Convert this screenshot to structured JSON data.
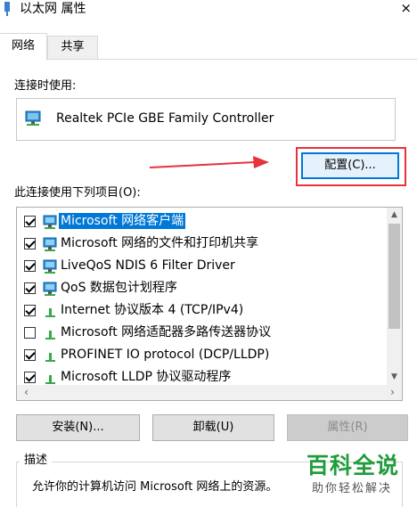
{
  "window": {
    "title": "以太网 属性",
    "close_glyph": "×"
  },
  "tabs": [
    {
      "label": "网络",
      "active": true
    },
    {
      "label": "共享",
      "active": false
    }
  ],
  "connection": {
    "label": "连接时使用:",
    "adapter_name": "Realtek PCIe GBE Family Controller",
    "configure_button": "配置(C)..."
  },
  "items": {
    "label": "此连接使用下列项目(O):",
    "list": [
      {
        "label": "Microsoft 网络客户端",
        "checked": true,
        "selected": true,
        "icon": "network-client-icon"
      },
      {
        "label": "Microsoft 网络的文件和打印机共享",
        "checked": true,
        "selected": false,
        "icon": "file-printer-sharing-icon"
      },
      {
        "label": "LiveQoS NDIS 6 Filter Driver",
        "checked": true,
        "selected": false,
        "icon": "network-service-icon"
      },
      {
        "label": "QoS 数据包计划程序",
        "checked": true,
        "selected": false,
        "icon": "network-service-icon"
      },
      {
        "label": "Internet 协议版本 4 (TCP/IPv4)",
        "checked": true,
        "selected": false,
        "icon": "protocol-icon"
      },
      {
        "label": "Microsoft 网络适配器多路传送器协议",
        "checked": false,
        "selected": false,
        "icon": "protocol-icon"
      },
      {
        "label": "PROFINET IO protocol (DCP/LLDP)",
        "checked": true,
        "selected": false,
        "icon": "protocol-icon"
      },
      {
        "label": "Microsoft LLDP 协议驱动程序",
        "checked": true,
        "selected": false,
        "icon": "protocol-icon"
      }
    ]
  },
  "buttons": {
    "install": "安装(N)...",
    "uninstall": "卸载(U)",
    "properties": "属性(R)"
  },
  "description": {
    "title": "描述",
    "text": "允许你的计算机访问 Microsoft 网络上的资源。"
  },
  "watermark": {
    "main": "百科全说",
    "sub": "助你轻松解决"
  },
  "colors": {
    "accent": "#0078d7",
    "highlight_box": "#e8323c",
    "arrow": "#e8323c",
    "watermark": "#1f9c3b"
  }
}
